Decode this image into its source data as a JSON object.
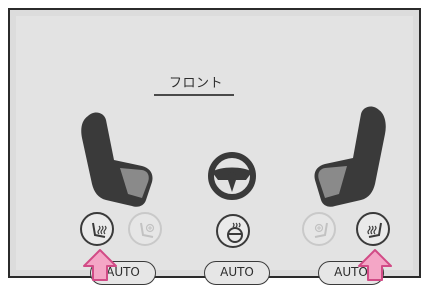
{
  "header": {
    "zone_label": "フロント"
  },
  "controls": {
    "left_auto_label": "AUTO",
    "center_auto_label": "AUTO",
    "right_auto_label": "AUTO"
  },
  "colors": {
    "seat_dark": "#3a3a3a",
    "seat_accent": "#8a8a8a",
    "arrow_fill": "#f4a6c6",
    "arrow_stroke": "#d14b86"
  }
}
